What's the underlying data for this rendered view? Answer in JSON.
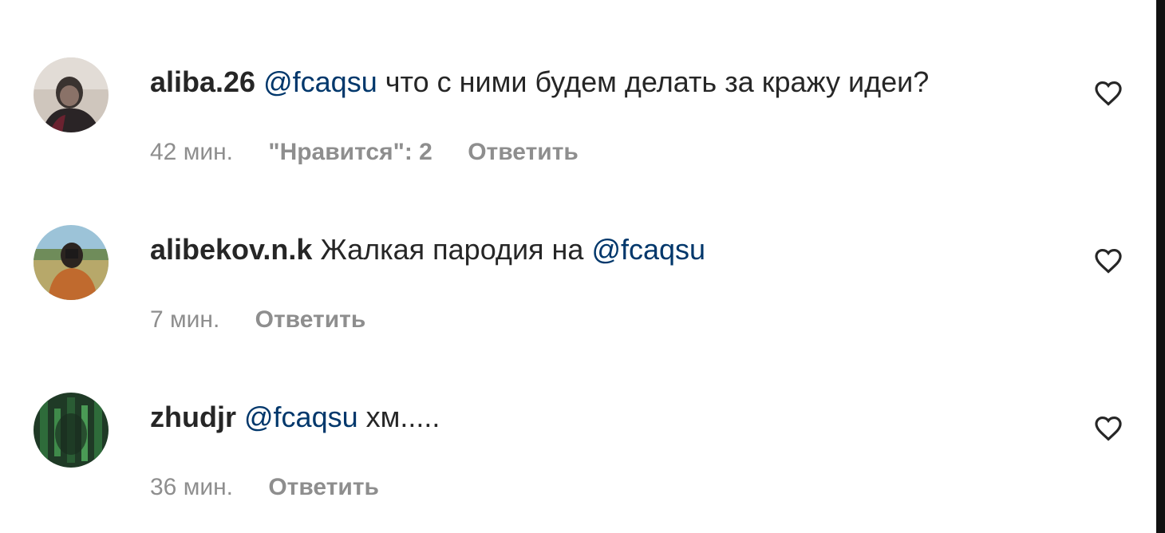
{
  "comments": [
    {
      "username": "aliba.26",
      "mention": "@fcaqsu",
      "text": "что с ними будем делать за кражу идеи?",
      "time": "42 мин.",
      "likes": "\"Нравится\": 2",
      "reply_label": "Ответить",
      "like_icon": "heart-outline-icon"
    },
    {
      "username": "alibekov.n.k",
      "text": "Жалкая пародия на",
      "mention": "@fcaqsu",
      "time": "7 мин.",
      "reply_label": "Ответить",
      "like_icon": "heart-outline-icon"
    },
    {
      "username": "zhudjr",
      "mention": "@fcaqsu",
      "text": "хм.....",
      "time": "36 мин.",
      "reply_label": "Ответить",
      "like_icon": "heart-outline-icon"
    }
  ],
  "colors": {
    "text": "#262626",
    "mention": "#00376b",
    "meta": "#8e8e8e"
  }
}
